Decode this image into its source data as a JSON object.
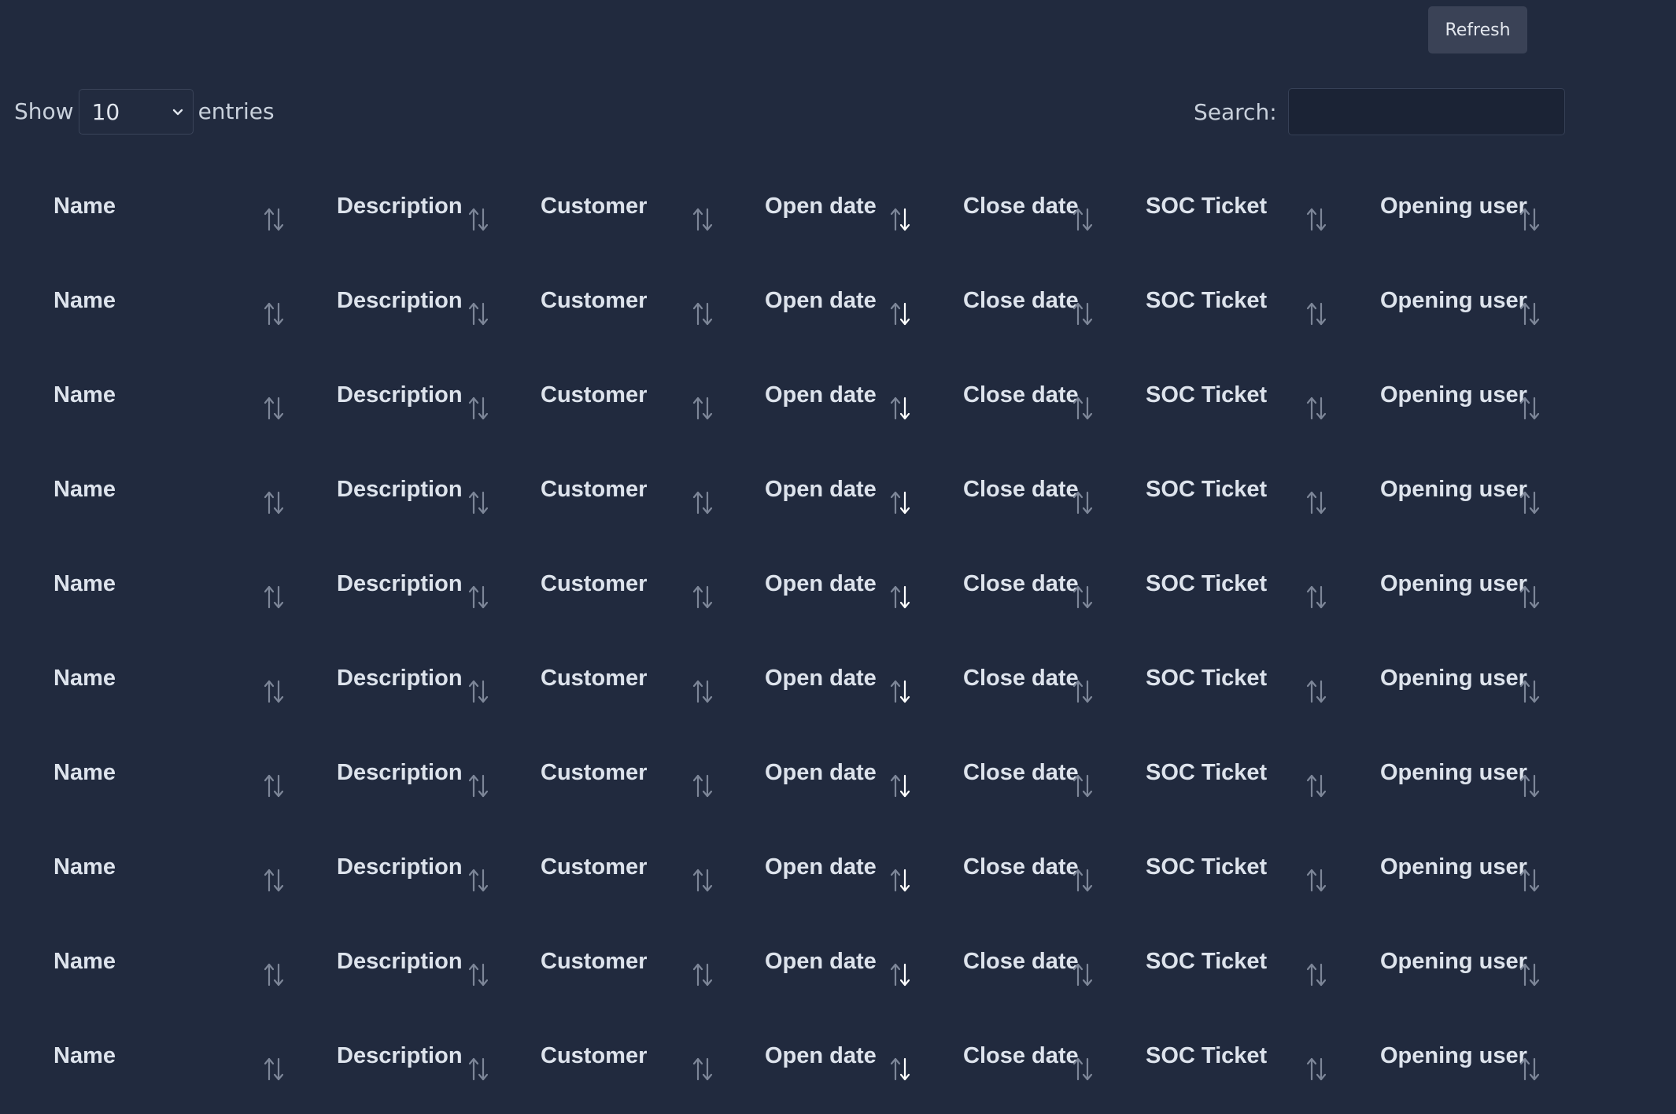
{
  "toolbar": {
    "refresh_label": "Refresh"
  },
  "length_menu": {
    "show_label": "Show",
    "selected_value": "10",
    "entries_label": "entries"
  },
  "search": {
    "label": "Search:",
    "value": "",
    "placeholder": ""
  },
  "table": {
    "columns": [
      {
        "label": "Name",
        "sort_icon": "sort-arrows-icon"
      },
      {
        "label": "Description",
        "sort_icon": "sort-arrows-icon"
      },
      {
        "label": "Customer",
        "sort_icon": "sort-arrows-icon"
      },
      {
        "label": "Open date",
        "sort_icon": "sort-arrows-icon",
        "sorted": "descending"
      },
      {
        "label": "Close date",
        "sort_icon": "sort-arrows-icon"
      },
      {
        "label": "SOC Ticket",
        "sort_icon": "sort-arrows-icon"
      },
      {
        "label": "Opening user",
        "sort_icon": "sort-arrows-icon"
      }
    ],
    "rows": [
      [
        "Name",
        "Description",
        "Customer",
        "Open date",
        "Close date",
        "SOC Ticket",
        "Opening user"
      ],
      [
        "Name",
        "Description",
        "Customer",
        "Open date",
        "Close date",
        "SOC Ticket",
        "Opening user"
      ],
      [
        "Name",
        "Description",
        "Customer",
        "Open date",
        "Close date",
        "SOC Ticket",
        "Opening user"
      ],
      [
        "Name",
        "Description",
        "Customer",
        "Open date",
        "Close date",
        "SOC Ticket",
        "Opening user"
      ],
      [
        "Name",
        "Description",
        "Customer",
        "Open date",
        "Close date",
        "SOC Ticket",
        "Opening user"
      ],
      [
        "Name",
        "Description",
        "Customer",
        "Open date",
        "Close date",
        "SOC Ticket",
        "Opening user"
      ],
      [
        "Name",
        "Description",
        "Customer",
        "Open date",
        "Close date",
        "SOC Ticket",
        "Opening user"
      ],
      [
        "Name",
        "Description",
        "Customer",
        "Open date",
        "Close date",
        "SOC Ticket",
        "Opening user"
      ],
      [
        "Name",
        "Description",
        "Customer",
        "Open date",
        "Close date",
        "SOC Ticket",
        "Opening user"
      ],
      [
        "Name",
        "Description",
        "Customer",
        "Open date",
        "Close date",
        "SOC Ticket",
        "Opening user"
      ]
    ]
  },
  "colors": {
    "background": "#212a3e",
    "button": "#3a4256",
    "text": "#dde3ec",
    "sort_icon": "#7d8698",
    "sort_active": "#ffffff"
  }
}
